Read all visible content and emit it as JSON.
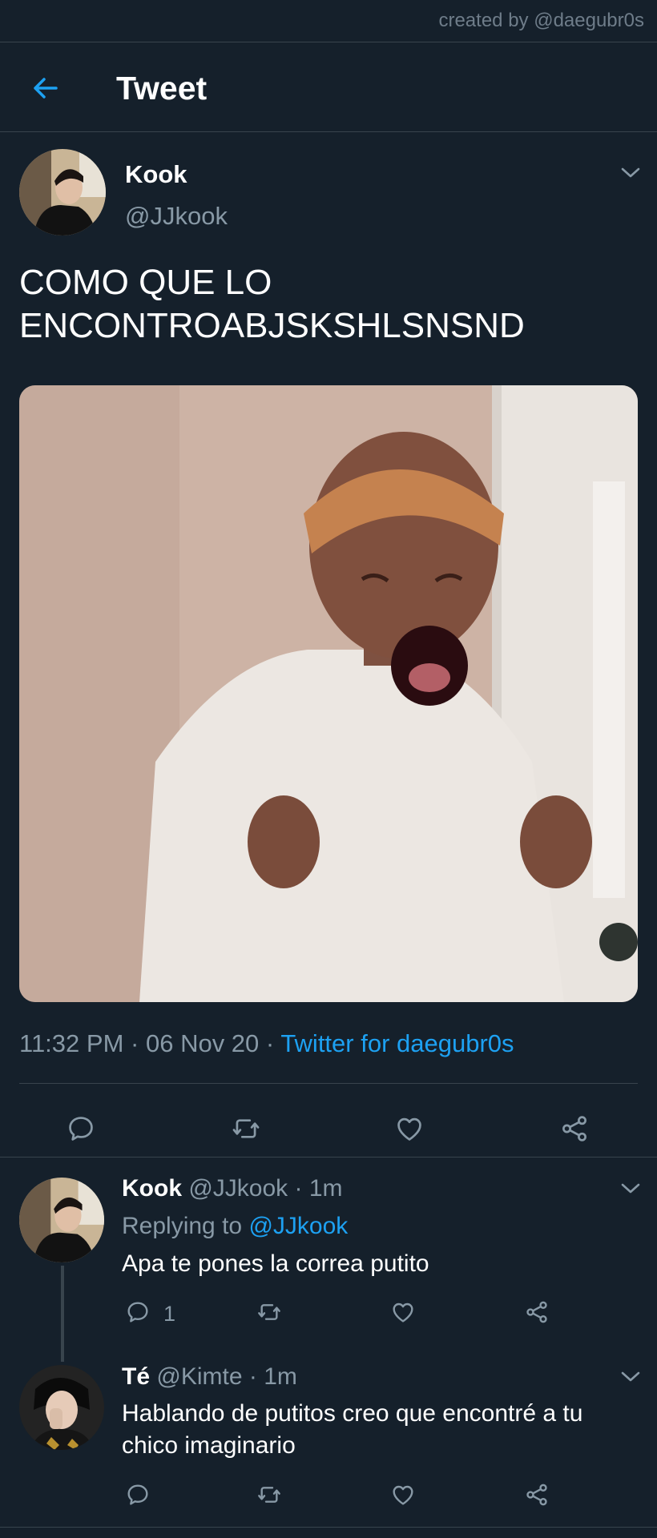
{
  "watermark": "created by @daegubr0s",
  "header": {
    "title": "Tweet"
  },
  "tweet": {
    "author_name": "Kook",
    "author_handle": "@JJkook",
    "text_line1": "COMO QUE LO",
    "text_line2": "ENCONTROABJSKSHLSNSND",
    "time": "11:32 PM",
    "date": "06 Nov 20",
    "source": "Twitter for daegubr0s",
    "separator": "·"
  },
  "replies": [
    {
      "name": "Kook",
      "handle": "@JJkook",
      "time": "1m",
      "replying_prefix": "Replying to",
      "replying_handle": "@JJkook",
      "text": "Apa te pones la correa putito",
      "reply_count": "1"
    },
    {
      "name": "Té",
      "handle": "@Kimte",
      "time": "1m",
      "text_line1": "Hablando de putitos creo que encontré a tu",
      "text_line2": "chico imaginario"
    }
  ],
  "colors": {
    "background": "#15202b",
    "accent": "#1da1f2",
    "muted": "#8899a6",
    "divider": "#38444d"
  },
  "icons": [
    "back-arrow-icon",
    "chevron-down-icon",
    "reply-icon",
    "retweet-icon",
    "like-icon",
    "share-icon"
  ]
}
